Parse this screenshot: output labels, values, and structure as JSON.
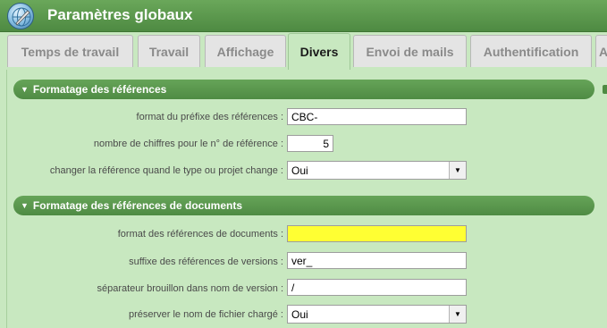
{
  "window": {
    "title": "Paramètres globaux",
    "icon": "globe-wrench-icon"
  },
  "tabs": [
    {
      "label": "Temps de travail",
      "active": false
    },
    {
      "label": "Travail",
      "active": false
    },
    {
      "label": "Affichage",
      "active": false
    },
    {
      "label": "Divers",
      "active": true
    },
    {
      "label": "Envoi de mails",
      "active": false
    },
    {
      "label": "Authentification",
      "active": false
    },
    {
      "label": "A",
      "active": false
    }
  ],
  "sections": [
    {
      "title": "Formatage des références",
      "fields": [
        {
          "label": "format du préfixe des références :",
          "value": "CBC-",
          "type": "text"
        },
        {
          "label": "nombre de chiffres pour le n° de référence :",
          "value": "5",
          "type": "number"
        },
        {
          "label": "changer la référence quand le type ou projet change :",
          "value": "Oui",
          "type": "select"
        }
      ]
    },
    {
      "title": "Formatage des références de documents",
      "fields": [
        {
          "label": "format des références de documents :",
          "value": "",
          "type": "text",
          "highlight": "#ffff33"
        },
        {
          "label": "suffixe des références de versions :",
          "value": "ver_",
          "type": "text"
        },
        {
          "label": "séparateur brouillon dans nom de version :",
          "value": "/",
          "type": "text"
        },
        {
          "label": "préserver le nom de fichier chargé :",
          "value": "Oui",
          "type": "select"
        }
      ]
    }
  ],
  "colors": {
    "accent": "#4e8a42",
    "panel": "#c8e8c0",
    "highlight": "#ffff33"
  }
}
